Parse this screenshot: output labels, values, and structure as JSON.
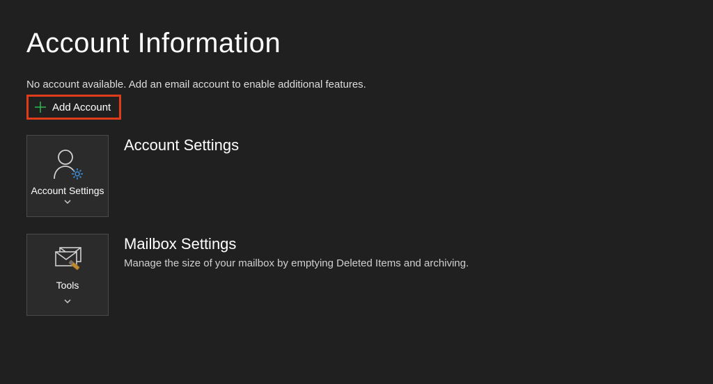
{
  "page": {
    "title": "Account Information",
    "no_account_message": "No account available. Add an email account to enable additional features.",
    "add_account_label": "Add Account"
  },
  "sections": {
    "account_settings": {
      "tile_label": "Account Settings",
      "heading": "Account Settings",
      "description": ""
    },
    "mailbox_settings": {
      "tile_label": "Tools",
      "heading": "Mailbox Settings",
      "description": "Manage the size of your mailbox by emptying Deleted Items and archiving."
    }
  },
  "colors": {
    "background": "#202020",
    "accent_green": "#2db84d",
    "highlight_border": "#e03c1a",
    "gear_blue": "#3d8bd4"
  }
}
